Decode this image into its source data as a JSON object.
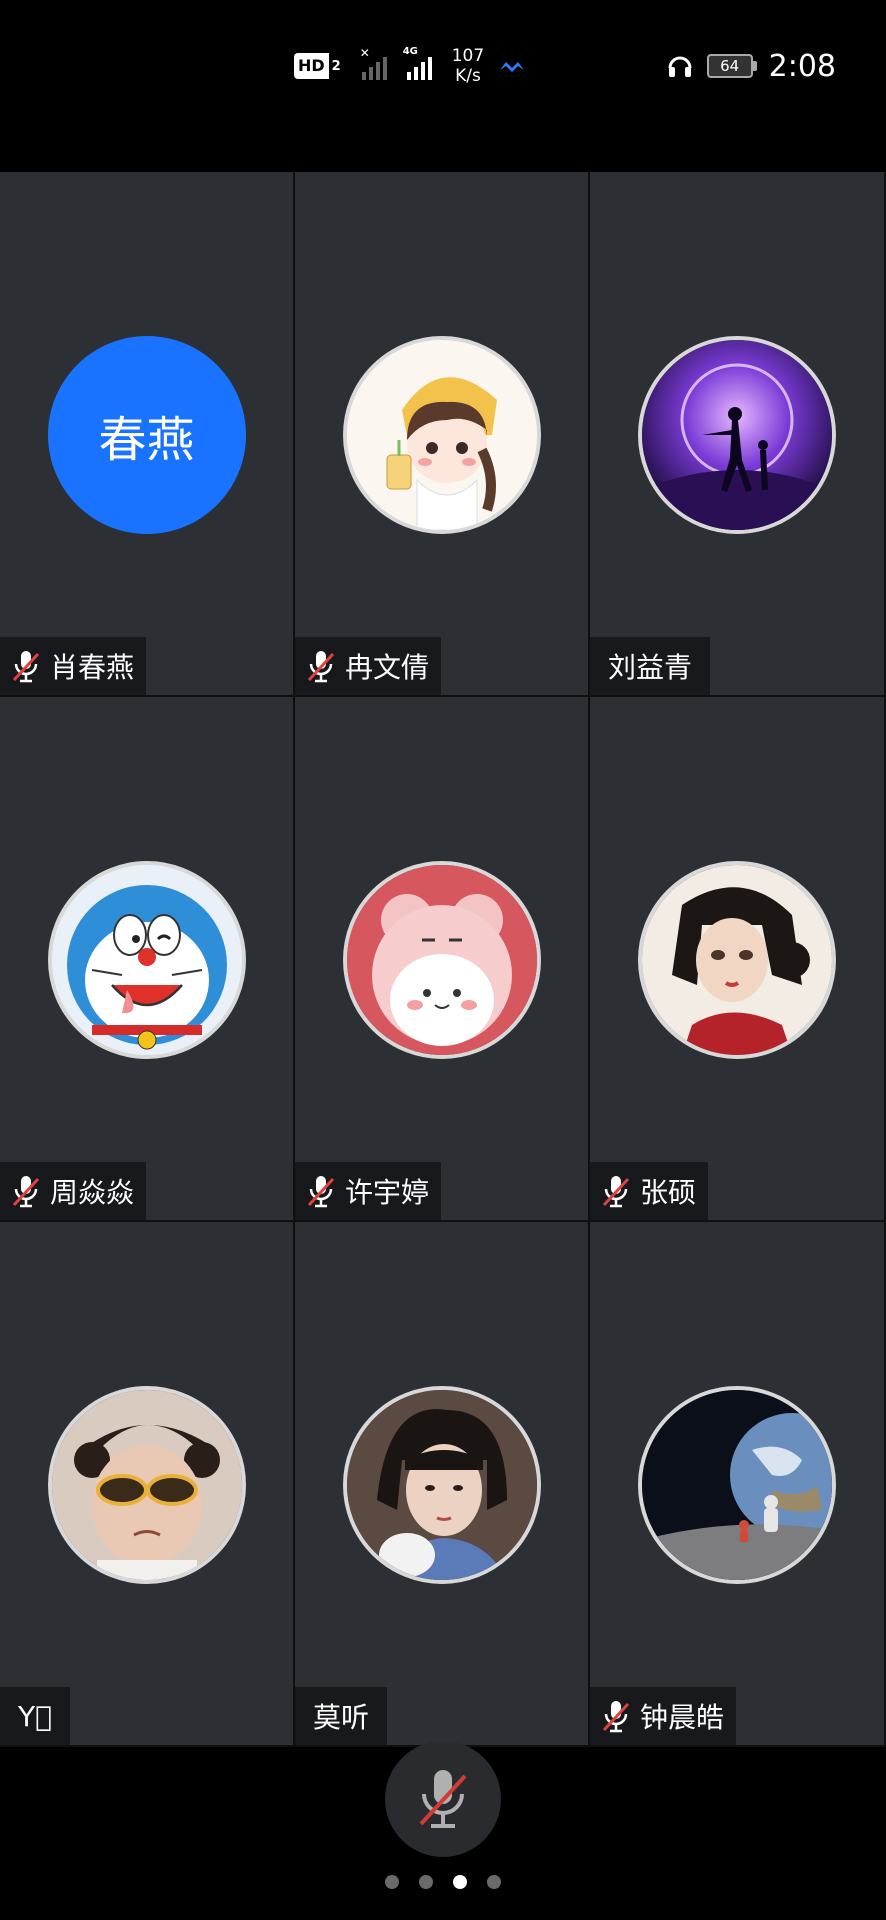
{
  "status_bar": {
    "hd_label": "HD",
    "hd_sub": "2",
    "net_type": "4G",
    "speed_value": "107",
    "speed_unit": "K/s",
    "battery": "64",
    "time": "2:08"
  },
  "participants": [
    {
      "name": "肖春燕",
      "muted": true,
      "avatar_text": "春燕",
      "avatar": "text-avatar-blue"
    },
    {
      "name": "冉文倩",
      "muted": true,
      "avatar": "cartoon-girl-avatar"
    },
    {
      "name": "刘益青",
      "muted": false,
      "avatar": "purple-galaxy-avatar"
    },
    {
      "name": "周焱焱",
      "muted": true,
      "avatar": "doraemon-avatar"
    },
    {
      "name": "许宇婷",
      "muted": true,
      "avatar": "pink-bear-avatar"
    },
    {
      "name": "张硕",
      "muted": true,
      "avatar": "painted-girl-avatar"
    },
    {
      "name": "Y\u0000",
      "muted": false,
      "avatar": "child-sunglasses-avatar"
    },
    {
      "name": "莫听",
      "muted": false,
      "avatar": "girl-photo-avatar"
    },
    {
      "name": "钟晨皓",
      "muted": true,
      "avatar": "astronaut-earth-avatar"
    }
  ],
  "colors": {
    "tile_bg": "#2c2f33",
    "accent_blue": "#1a73ff",
    "mute_red": "#e0413d"
  },
  "pager": {
    "count": 4,
    "active_index": 2
  }
}
